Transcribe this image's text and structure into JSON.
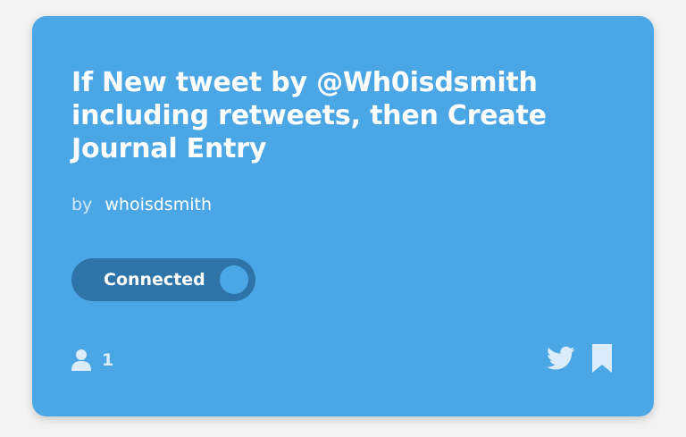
{
  "applet": {
    "title": "If New tweet by @Wh0isdsmith including retweets, then Create Journal Entry",
    "by_prefix": "by",
    "author": "whoisdsmith",
    "toggle_label": "Connected",
    "user_count": "1"
  },
  "icons": {
    "users": "user-icon",
    "service": "twitter-icon",
    "save": "bookmark-icon"
  },
  "colors": {
    "card_background": "#4ba6e6",
    "toggle_background": "#2e74a8",
    "text": "#ffffff"
  }
}
